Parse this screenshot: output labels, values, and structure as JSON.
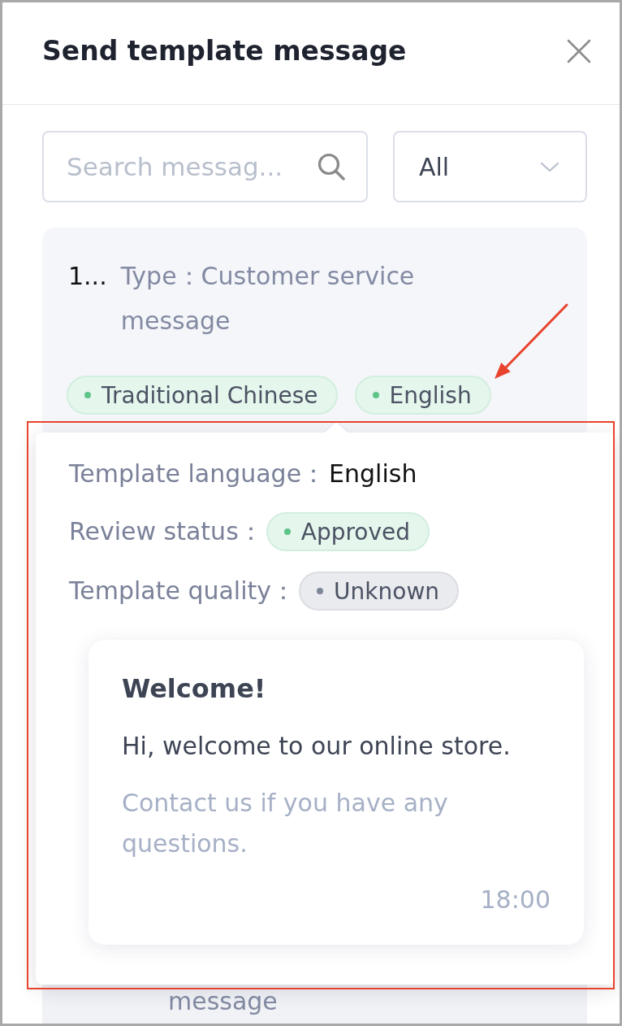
{
  "window": {
    "title": "Send template message"
  },
  "search": {
    "placeholder": "Search messag..."
  },
  "filter": {
    "value": "All"
  },
  "templates": [
    {
      "index": "1...",
      "type": "Type：Customer service message",
      "languages": [
        {
          "label": "Traditional Chinese"
        },
        {
          "label": "English"
        }
      ]
    },
    {
      "type": "message"
    }
  ],
  "popover": {
    "rows": [
      {
        "kind": "text",
        "label": "Template language：",
        "value": "English"
      },
      {
        "kind": "badge",
        "label": "Review status：",
        "value": "Approved",
        "color": "#5ec48a"
      },
      {
        "kind": "badge",
        "label": "Template quality：",
        "value": "Unknown",
        "color": "#7d8599"
      }
    ],
    "preview": {
      "header": "Welcome!",
      "body": "Hi, welcome to our online store.",
      "footer": "Contact us if you have any questions.",
      "time": "18:00"
    }
  }
}
